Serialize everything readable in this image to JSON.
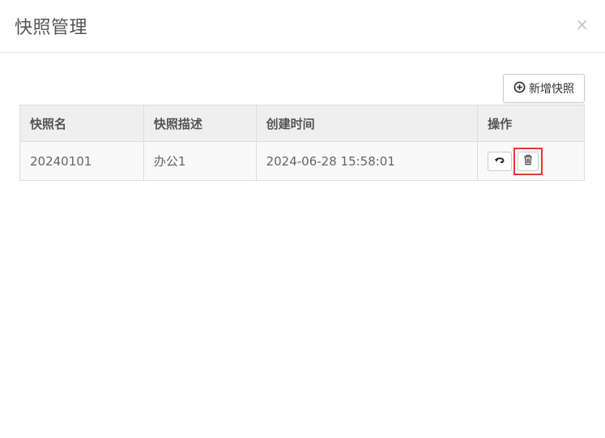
{
  "dialog": {
    "title": "快照管理",
    "close_glyph": "×"
  },
  "toolbar": {
    "add_label": "新增快照",
    "add_icon": "plus-circle-icon"
  },
  "table": {
    "headers": [
      "快照名",
      "快照描述",
      "创建时间",
      "操作"
    ],
    "rows": [
      {
        "name": "20240101",
        "description": "办公1",
        "created": "2024-06-28 15:58:01",
        "actions": [
          "restore-icon",
          "trash-icon"
        ]
      }
    ]
  },
  "highlight_color": "#e53935"
}
